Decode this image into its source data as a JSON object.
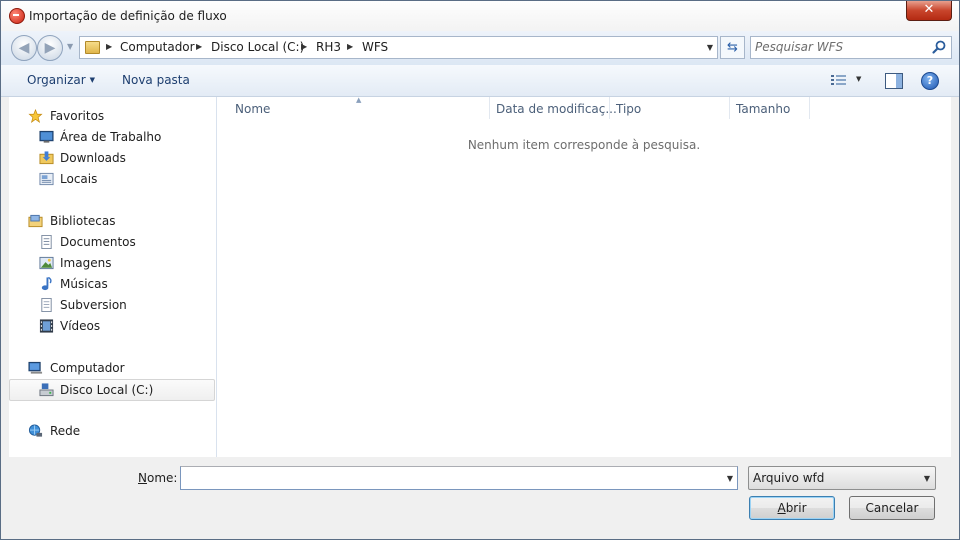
{
  "window": {
    "title": "Importação de definição de fluxo",
    "close_label": "✕"
  },
  "navigation": {
    "back_label": "◀",
    "forward_label": "▶",
    "breadcrumb": [
      "Computador",
      "Disco Local (C:)",
      "RH3",
      "WFS"
    ],
    "search_placeholder": "Pesquisar WFS"
  },
  "toolbar": {
    "organize_label": "Organizar",
    "new_folder_label": "Nova pasta",
    "help_label": "?"
  },
  "sidebar": {
    "favorites": {
      "label": "Favoritos",
      "items": [
        "Área de Trabalho",
        "Downloads",
        "Locais"
      ]
    },
    "libraries": {
      "label": "Bibliotecas",
      "items": [
        "Documentos",
        "Imagens",
        "Músicas",
        "Subversion",
        "Vídeos"
      ]
    },
    "computer": {
      "label": "Computador",
      "items": [
        "Disco Local (C:)"
      ],
      "selected": "Disco Local (C:)"
    },
    "network": {
      "label": "Rede"
    }
  },
  "filelist": {
    "columns": [
      "Nome",
      "Data de modificaç...",
      "Tipo",
      "Tamanho"
    ],
    "empty_message": "Nenhum item corresponde à pesquisa."
  },
  "bottom": {
    "name_label_prefix": "N",
    "name_label_rest": "ome:",
    "name_value": "",
    "file_type": "Arquivo wfd",
    "open_label_prefix": "A",
    "open_label_rest": "brir",
    "cancel_label": "Cancelar"
  },
  "colors": {
    "accent": "#1e3f70",
    "selected_border": "#d5d5d5"
  }
}
